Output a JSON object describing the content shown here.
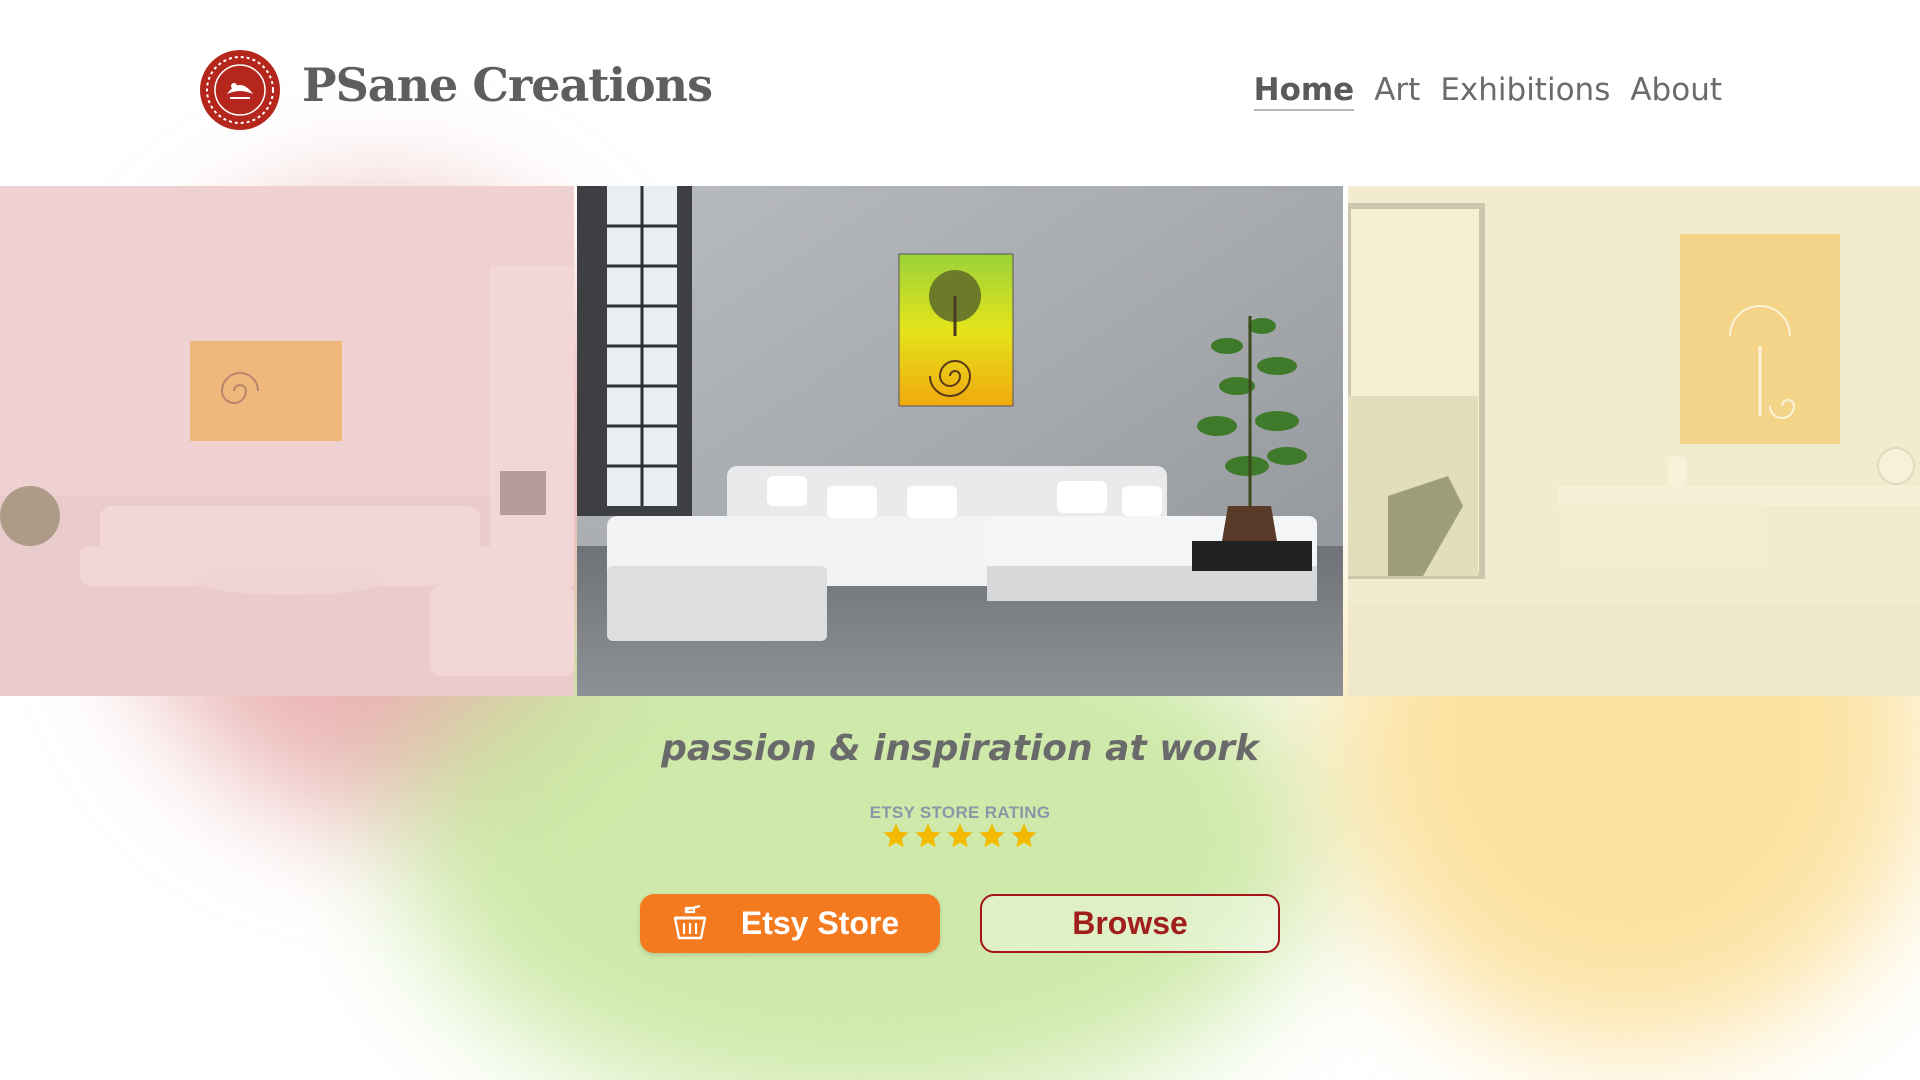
{
  "brand": {
    "name": "PSane Creations",
    "logo_color": "#b5271c"
  },
  "nav": {
    "items": [
      {
        "label": "Home",
        "active": true
      },
      {
        "label": "Art",
        "active": false
      },
      {
        "label": "Exhibitions",
        "active": false
      },
      {
        "label": "About",
        "active": false
      }
    ]
  },
  "hero": {
    "tagline": "passion & inspiration at work",
    "rating_label": "ETSY STORE RATING",
    "rating_stars": 5,
    "rating_max": 5
  },
  "buttons": {
    "etsy_label": "Etsy Store",
    "etsy_icon": "shopping-basket-icon",
    "browse_label": "Browse"
  },
  "colors": {
    "accent_orange": "#f47a1f",
    "accent_red": "#a4151b",
    "star_gold": "#f5b800",
    "blob_red": "#da7878",
    "blob_green": "#bee18c",
    "blob_yellow": "#fad26e"
  }
}
